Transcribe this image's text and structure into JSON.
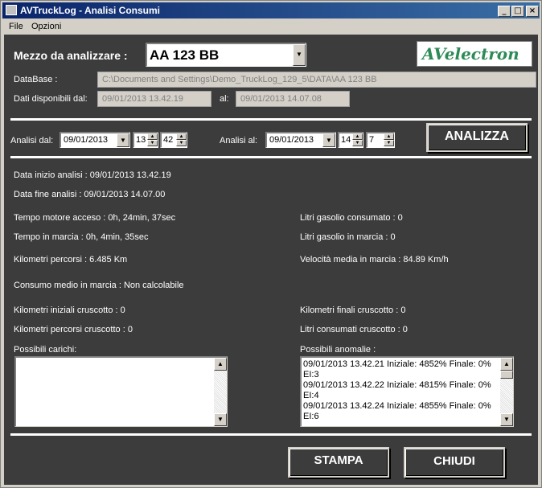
{
  "window": {
    "title": "AVTruckLog - Analisi Consumi",
    "min_label": "_",
    "max_label": "□",
    "close_label": "×"
  },
  "menu": {
    "file": "File",
    "options": "Opzioni"
  },
  "header": {
    "vehicle_label": "Mezzo da analizzare :",
    "vehicle_value": "AA 123 BB",
    "logo_text": "AVelectron",
    "database_label": "DataBase :",
    "database_value": "C:\\Documents and Settings\\Demo_TruckLog_129_5\\DATA\\AA 123 BB",
    "available_from_label": "Dati disponibili dal:",
    "available_from_value": "09/01/2013 13.42.19",
    "available_to_label": "al:",
    "available_to_value": "09/01/2013 14.07.08"
  },
  "range": {
    "from_label": "Analisi dal:",
    "from_date": "09/01/2013",
    "from_hour": "13",
    "from_min": "42",
    "to_label": "Analisi al:",
    "to_date": "09/01/2013",
    "to_hour": "14",
    "to_min": "7",
    "analyze_button": "ANALIZZA"
  },
  "results": {
    "start": "Data inizio analisi : 09/01/2013 13.42.19",
    "end": "Data fine analisi : 09/01/2013 14.07.00",
    "engine_on": "Tempo motore acceso :  0h,  24min,  37sec",
    "fuel_consumed": "Litri gasolio consumato :  0",
    "moving_time": "Tempo in marcia :  0h,  4min,  35sec",
    "fuel_moving": "Litri gasolio in marcia :  0",
    "km": "Kilometri percorsi :  6.485 Km",
    "avg_speed": "Velocità media in marcia :  84.89 Km/h",
    "avg_consumption": "Consumo medio in marcia : Non calcolabile",
    "km_start_dash": "Kilometri iniziali cruscotto :  0",
    "km_end_dash": "Kilometri finali cruscotto :  0",
    "km_dash": "Kilometri percorsi cruscotto :  0",
    "liters_dash": "Litri consumati cruscotto :  0",
    "loads_label": "Possibili carichi:",
    "anomalies_label": "Possibili anomalie :",
    "anomalies": [
      "09/01/2013 13.42.21 Iniziale:  4852% Finale:  0%",
      "EI:3",
      "09/01/2013 13.42.22 Iniziale:  4815% Finale:  0%",
      "EI:4",
      "09/01/2013 13.42.24 Iniziale:  4855% Finale:  0%",
      "EI:6"
    ]
  },
  "footer": {
    "print_button": "STAMPA",
    "close_button": "CHIUDI"
  }
}
